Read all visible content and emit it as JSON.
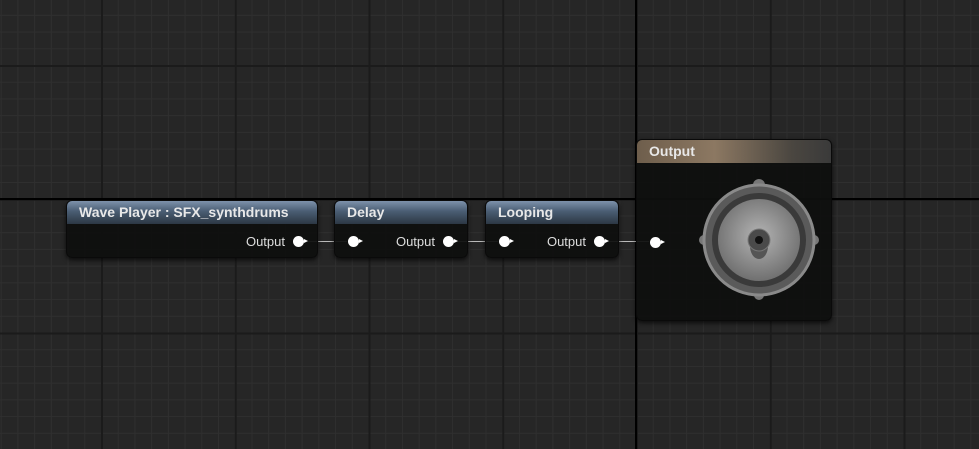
{
  "graph": {
    "nodes": [
      {
        "title": "Wave Player : SFX_synthdrums",
        "output_label": "Output"
      },
      {
        "title": "Delay",
        "output_label": "Output"
      },
      {
        "title": "Looping",
        "output_label": "Output"
      },
      {
        "title": "Output",
        "icon": "speaker-icon"
      }
    ]
  }
}
